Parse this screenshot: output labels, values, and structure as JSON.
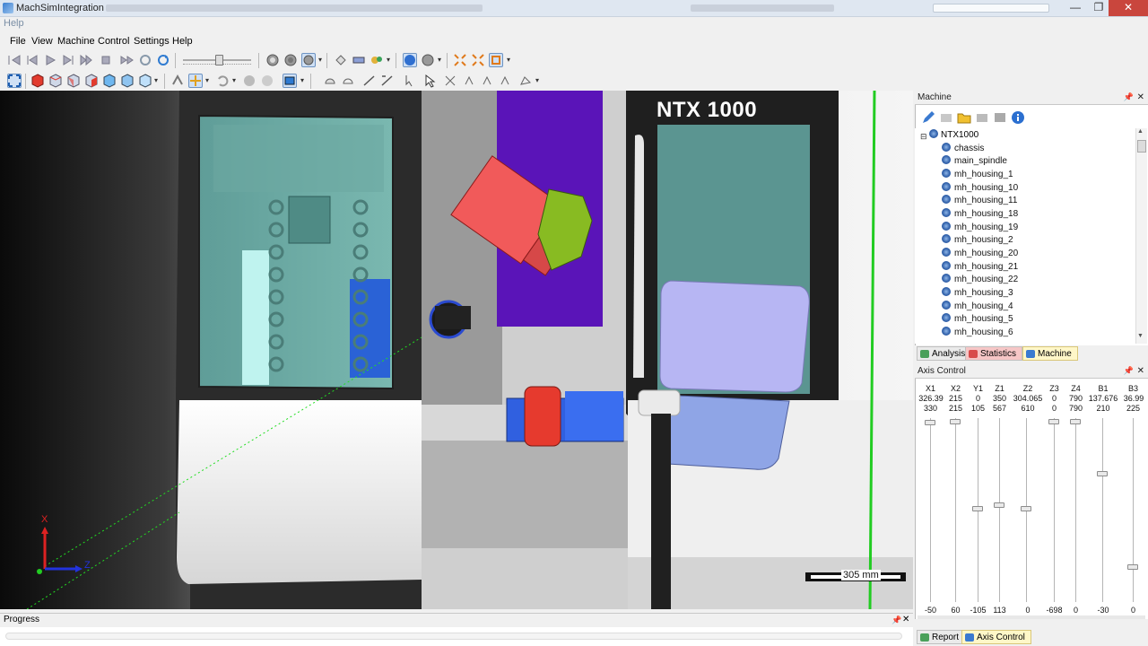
{
  "window": {
    "title": "MachSimIntegration",
    "minimize": "—",
    "restore": "❐",
    "close": "✕"
  },
  "help_strip": "Help",
  "menu": [
    "File",
    "View",
    "Machine",
    "Control",
    "Settings",
    "Help"
  ],
  "viewport": {
    "brand": "NTX 1000",
    "scale_label": "305 mm",
    "axis_x": "X",
    "axis_z": "Z"
  },
  "machine_panel": {
    "title": "Machine",
    "root": "NTX1000",
    "items": [
      "chassis",
      "main_spindle",
      "mh_housing_1",
      "mh_housing_10",
      "mh_housing_11",
      "mh_housing_18",
      "mh_housing_19",
      "mh_housing_2",
      "mh_housing_20",
      "mh_housing_21",
      "mh_housing_22",
      "mh_housing_3",
      "mh_housing_4",
      "mh_housing_5",
      "mh_housing_6"
    ],
    "tabs": [
      "Analysis",
      "Statistics",
      "Machine"
    ]
  },
  "axis_panel": {
    "title": "Axis Control",
    "columns": [
      "X1",
      "X2",
      "Y1",
      "Z1",
      "Z2",
      "Z3",
      "Z4",
      "B1",
      "B3"
    ],
    "row1": [
      "326.39",
      "215",
      "0",
      "350",
      "304.065",
      "0",
      "790",
      "137.676",
      "36.99"
    ],
    "row2": [
      "330",
      "215",
      "105",
      "567",
      "610",
      "0",
      "790",
      "210",
      "225"
    ],
    "bottom": [
      "-50",
      "60",
      "-105",
      "113",
      "0",
      "-698",
      "0",
      "-30",
      "0"
    ],
    "tabs": [
      "Report",
      "Axis Control"
    ]
  },
  "progress": {
    "title": "Progress"
  },
  "colors": {
    "accent": "#3b7fd0",
    "tab_active_machine": "#fff7c8",
    "tab_statistics": "#f6c6c6",
    "ntx_green_line": "#22cc22"
  }
}
